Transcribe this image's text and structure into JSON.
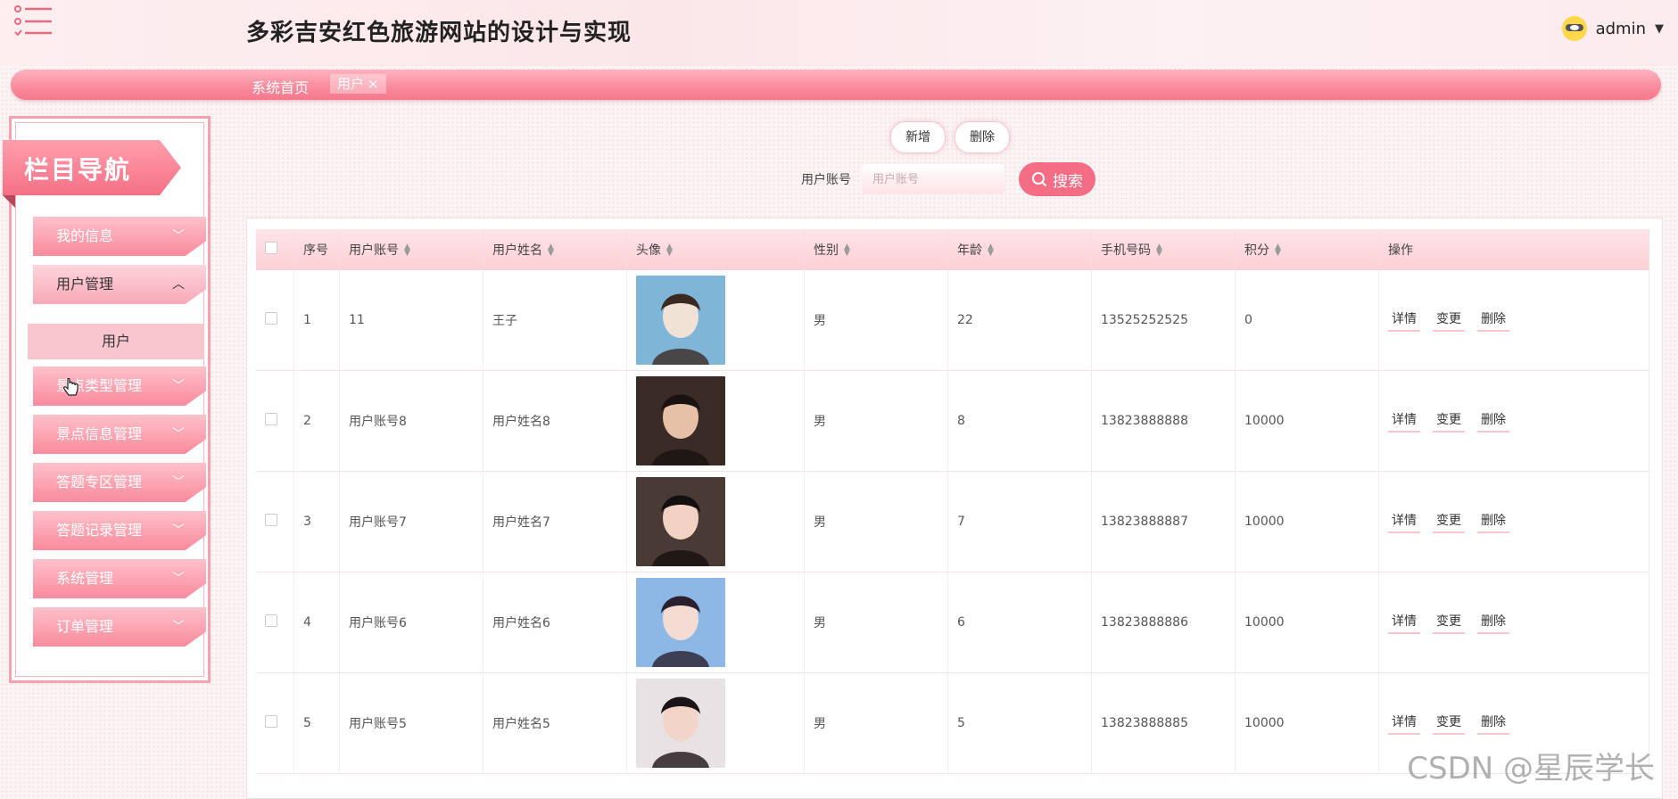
{
  "header": {
    "title": "多彩吉安红色旅游网站的设计与实现",
    "username": "admin",
    "caret": "▼"
  },
  "breadcrumb": {
    "home": "系统首页",
    "current_tab": "用户",
    "close": "×"
  },
  "sidebar": {
    "banner": "栏目导航",
    "items": [
      {
        "label": "我的信息",
        "chevron": "﹀"
      },
      {
        "label": "用户管理",
        "chevron": "︿"
      },
      {
        "label": "景点类型管理",
        "chevron": "﹀"
      },
      {
        "label": "景点信息管理",
        "chevron": "﹀"
      },
      {
        "label": "答题专区管理",
        "chevron": "﹀"
      },
      {
        "label": "答题记录管理",
        "chevron": "﹀"
      },
      {
        "label": "系统管理",
        "chevron": "﹀"
      },
      {
        "label": "订单管理",
        "chevron": "﹀"
      }
    ],
    "sub_item": "用户"
  },
  "toolbar": {
    "add_label": "新增",
    "delete_label": "删除",
    "search_label": "用户账号",
    "search_placeholder": "用户账号",
    "search_button": "搜索"
  },
  "table": {
    "headers": [
      "序号",
      "用户账号",
      "用户姓名",
      "头像",
      "性别",
      "年龄",
      "手机号码",
      "积分",
      "操作"
    ],
    "row_actions": [
      "详情",
      "变更",
      "删除"
    ],
    "rows": [
      {
        "no": "1",
        "account": "11",
        "name": "王子",
        "gender": "男",
        "age": "22",
        "phone": "13525252525",
        "points": "0"
      },
      {
        "no": "2",
        "account": "用户账号8",
        "name": "用户姓名8",
        "gender": "男",
        "age": "8",
        "phone": "13823888888",
        "points": "10000"
      },
      {
        "no": "3",
        "account": "用户账号7",
        "name": "用户姓名7",
        "gender": "男",
        "age": "7",
        "phone": "13823888887",
        "points": "10000"
      },
      {
        "no": "4",
        "account": "用户账号6",
        "name": "用户姓名6",
        "gender": "男",
        "age": "6",
        "phone": "13823888886",
        "points": "10000"
      },
      {
        "no": "5",
        "account": "用户账号5",
        "name": "用户姓名5",
        "gender": "男",
        "age": "5",
        "phone": "13823888885",
        "points": "10000"
      }
    ]
  },
  "watermark": "CSDN @星辰学长",
  "colors": {
    "accent": "#f56d84",
    "pink_light": "#f9c6ce"
  }
}
